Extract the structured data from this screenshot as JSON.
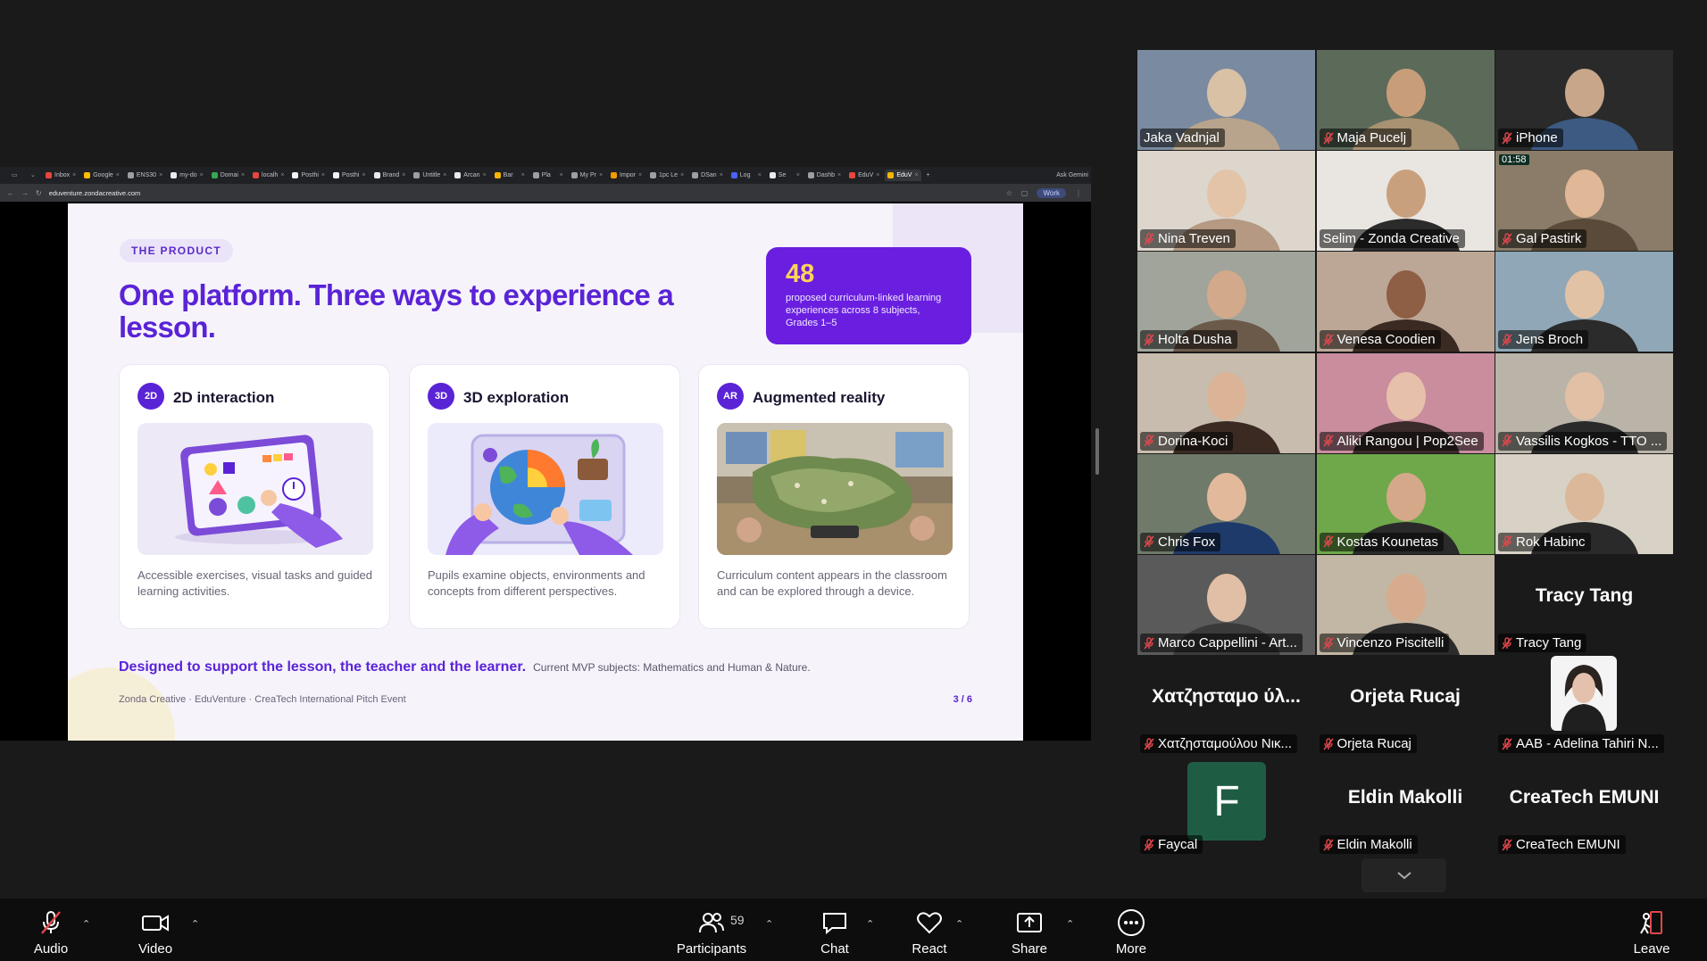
{
  "browser": {
    "tabs": [
      {
        "label": "Inbox",
        "color": "#e8453c"
      },
      {
        "label": "Google",
        "color": "#fbbc04"
      },
      {
        "label": "ENS30",
        "color": "#9aa0a6"
      },
      {
        "label": "my-do",
        "color": "#e8eaed"
      },
      {
        "label": "Domai",
        "color": "#34a853"
      },
      {
        "label": "localh",
        "color": "#e8453c"
      },
      {
        "label": "Posthi",
        "color": "#f2f2f2"
      },
      {
        "label": "Posthi",
        "color": "#f2f2f2"
      },
      {
        "label": "Brand",
        "color": "#e8eaed"
      },
      {
        "label": "Untitle",
        "color": "#9aa0a6"
      },
      {
        "label": "Arcan",
        "color": "#e8eaed"
      },
      {
        "label": "Bar",
        "color": "#f4b400"
      },
      {
        "label": "Pla",
        "color": "#9aa0a6"
      },
      {
        "label": "My Pr",
        "color": "#9aa0a6"
      },
      {
        "label": "Impor",
        "color": "#f29900"
      },
      {
        "label": "1pc Le",
        "color": "#9aa0a6"
      },
      {
        "label": "DSan",
        "color": "#9aa0a6"
      },
      {
        "label": "Log",
        "color": "#4a63ff"
      },
      {
        "label": "Se",
        "color": "#e8eaed"
      },
      {
        "label": "Dashb",
        "color": "#9aa0a6"
      },
      {
        "label": "EduV",
        "color": "#e8453c"
      },
      {
        "label": "EduV",
        "color": "#f4b400"
      }
    ],
    "new_tab": "+",
    "profile": "Ask Gemini",
    "url": "eduventure.zondacreative.com",
    "star": "☆",
    "work_label": "Work"
  },
  "slide": {
    "eyebrow": "THE PRODUCT",
    "title": "One platform. Three ways to experience a lesson.",
    "stat_number": "48",
    "stat_text": "proposed curriculum-linked learning experiences across 8 subjects, Grades 1–5",
    "cards": [
      {
        "badge": "2D",
        "title": "2D interaction",
        "desc": "Accessible exercises, visual tasks and guided learning activities."
      },
      {
        "badge": "3D",
        "title": "3D exploration",
        "desc": "Pupils examine objects, environments and concepts from different perspectives."
      },
      {
        "badge": "AR",
        "title": "Augmented reality",
        "desc": "Curriculum content appears in the classroom and can be explored through a device."
      }
    ],
    "tagline": "Designed to support the lesson, the teacher and the learner.",
    "subjects": "Current MVP subjects: Mathematics and Human & Nature.",
    "footer": "Zonda Creative · EduVenture · CreaTech International Pitch Event",
    "page": "3 / 6"
  },
  "participants": [
    {
      "name": "Jaka Vadnjal",
      "muted": false
    },
    {
      "name": "Maja Pucelj",
      "muted": true
    },
    {
      "name": "iPhone",
      "muted": true
    },
    {
      "name": "Nina Treven",
      "muted": true
    },
    {
      "name": "Selim - Zonda Creative",
      "muted": false,
      "speaking": true
    },
    {
      "name": "Gal Pastirk",
      "muted": true
    },
    {
      "name": "Holta Dusha",
      "muted": true
    },
    {
      "name": "Venesa Coodien",
      "muted": true
    },
    {
      "name": "Jens Broch",
      "muted": true
    },
    {
      "name": "Dorina-Koci",
      "muted": true
    },
    {
      "name": "Aliki Rangou | Pop2See",
      "muted": true
    },
    {
      "name": "Vassilis Kogkos - TTO ...",
      "muted": true
    },
    {
      "name": "Chris Fox",
      "muted": true
    },
    {
      "name": "Kostas Kounetas",
      "muted": true
    },
    {
      "name": "Rok Habinc",
      "muted": true
    },
    {
      "name": "Marco Cappellini - Art...",
      "muted": true
    },
    {
      "name": "Vincenzo Piscitelli",
      "muted": true
    },
    {
      "name": "Tracy Tang",
      "muted": true,
      "display": "Tracy Tang"
    },
    {
      "name": "Χατζησταμούλου Νικ...",
      "muted": true,
      "display": "Χατζησταμο ύλ..."
    },
    {
      "name": "Orjeta Rucaj",
      "muted": true,
      "display": "Orjeta Rucaj"
    },
    {
      "name": "AAB - Adelina Tahiri N...",
      "muted": true
    },
    {
      "name": "Faycal",
      "muted": true,
      "avatar_letter": "F"
    },
    {
      "name": "Eldin Makolli",
      "muted": true,
      "display": "Eldin Makolli"
    },
    {
      "name": "CreaTech EMUNI",
      "muted": true,
      "display": "CreaTech EMUNI"
    }
  ],
  "gal_timer": "01:58",
  "toolbar": {
    "audio": "Audio",
    "video": "Video",
    "participants": "Participants",
    "participants_count": "59",
    "chat": "Chat",
    "react": "React",
    "share": "Share",
    "more": "More",
    "leave": "Leave",
    "caret": "⌃"
  },
  "colors": {
    "accent_purple": "#5a23d6",
    "stat_yellow": "#ffd25a",
    "speaking_green": "#23d96b",
    "muted_red": "#e0474c"
  }
}
